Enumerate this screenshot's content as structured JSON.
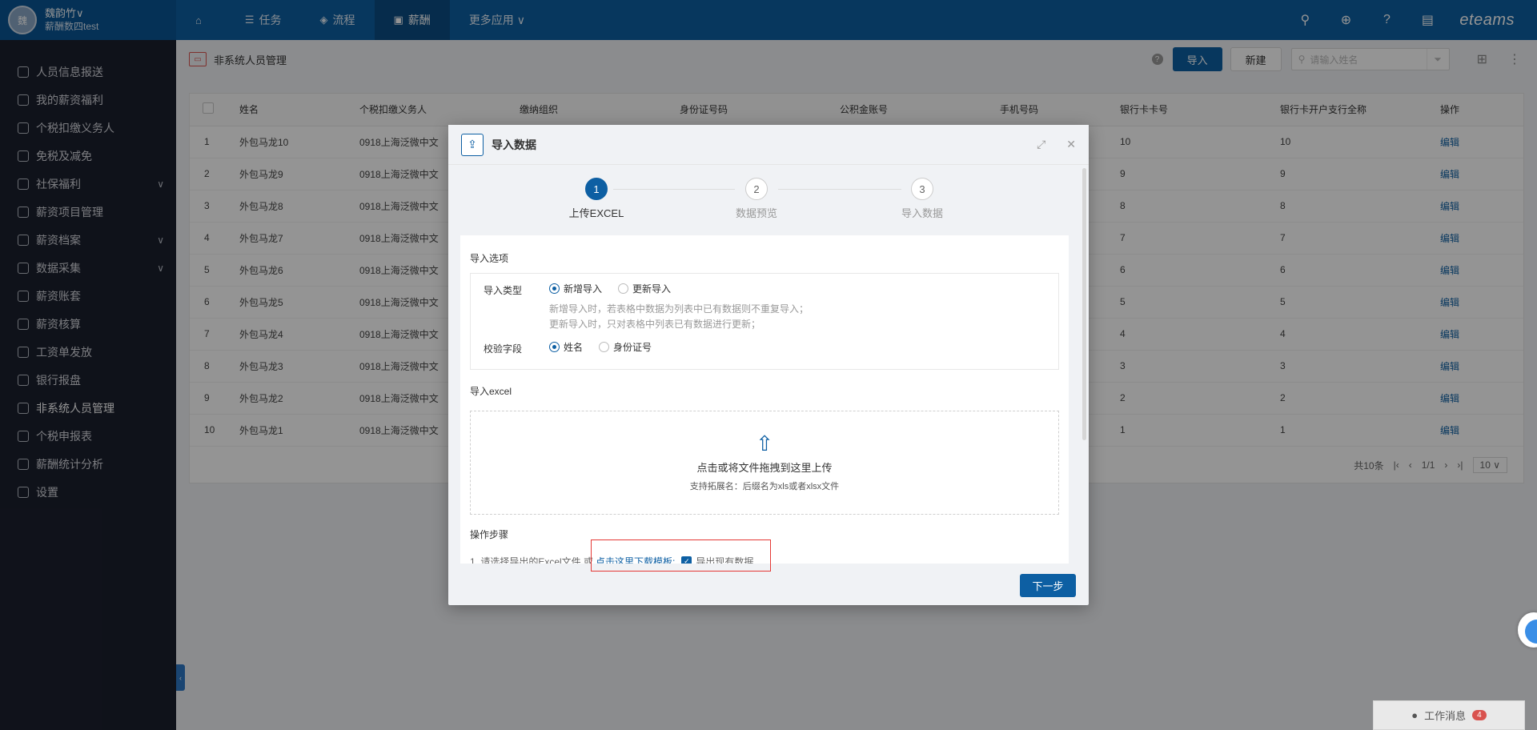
{
  "user": {
    "avatar": "魏",
    "name": "魏韵竹∨",
    "org": "薪酬数四test"
  },
  "nav": [
    {
      "icon": "⌂",
      "label": ""
    },
    {
      "icon": "☰",
      "label": "任务"
    },
    {
      "icon": "◈",
      "label": "流程"
    },
    {
      "icon": "▣",
      "label": "薪酬"
    },
    {
      "icon": "",
      "label": "更多应用 ∨"
    }
  ],
  "brand": "eteams",
  "sidebar": [
    {
      "label": "人员信息报送"
    },
    {
      "label": "我的薪资福利"
    },
    {
      "label": "个税扣缴义务人"
    },
    {
      "label": "免税及减免"
    },
    {
      "label": "社保福利",
      "chev": "∨"
    },
    {
      "label": "薪资项目管理"
    },
    {
      "label": "薪资档案",
      "chev": "∨"
    },
    {
      "label": "数据采集",
      "chev": "∨"
    },
    {
      "label": "薪资账套"
    },
    {
      "label": "薪资核算"
    },
    {
      "label": "工资单发放"
    },
    {
      "label": "银行报盘"
    },
    {
      "label": "非系统人员管理"
    },
    {
      "label": "个税申报表"
    },
    {
      "label": "薪酬统计分析"
    },
    {
      "label": "设置"
    }
  ],
  "page": {
    "title": "非系统人员管理",
    "import": "导入",
    "new": "新建",
    "search_placeholder": "请输入姓名"
  },
  "table": {
    "headers": [
      "姓名",
      "个税扣缴义务人",
      "缴纳组织",
      "身份证号码",
      "公积金账号",
      "手机号码",
      "银行卡卡号",
      "银行卡开户支行全称",
      "操作"
    ],
    "rows": [
      {
        "no": "1",
        "name": "外包马龙10",
        "tax": "0918上海泛微中文",
        "card": "10",
        "branch": "10",
        "op": "编辑"
      },
      {
        "no": "2",
        "name": "外包马龙9",
        "tax": "0918上海泛微中文",
        "card": "9",
        "branch": "9",
        "op": "编辑"
      },
      {
        "no": "3",
        "name": "外包马龙8",
        "tax": "0918上海泛微中文",
        "card": "8",
        "branch": "8",
        "op": "编辑"
      },
      {
        "no": "4",
        "name": "外包马龙7",
        "tax": "0918上海泛微中文",
        "card": "7",
        "branch": "7",
        "op": "编辑"
      },
      {
        "no": "5",
        "name": "外包马龙6",
        "tax": "0918上海泛微中文",
        "card": "6",
        "branch": "6",
        "op": "编辑"
      },
      {
        "no": "6",
        "name": "外包马龙5",
        "tax": "0918上海泛微中文",
        "card": "5",
        "branch": "5",
        "op": "编辑"
      },
      {
        "no": "7",
        "name": "外包马龙4",
        "tax": "0918上海泛微中文",
        "card": "4",
        "branch": "4",
        "op": "编辑"
      },
      {
        "no": "8",
        "name": "外包马龙3",
        "tax": "0918上海泛微中文",
        "card": "3",
        "branch": "3",
        "op": "编辑"
      },
      {
        "no": "9",
        "name": "外包马龙2",
        "tax": "0918上海泛微中文",
        "card": "2",
        "branch": "2",
        "op": "编辑"
      },
      {
        "no": "10",
        "name": "外包马龙1",
        "tax": "0918上海泛微中文",
        "card": "1",
        "branch": "1",
        "op": "编辑"
      }
    ]
  },
  "pager": {
    "total": "共10条",
    "page": "1/1",
    "size": "10 ∨"
  },
  "modal": {
    "title": "导入数据",
    "steps": [
      {
        "num": "1",
        "label": "上传EXCEL"
      },
      {
        "num": "2",
        "label": "数据预览"
      },
      {
        "num": "3",
        "label": "导入数据"
      }
    ],
    "options_title": "导入选项",
    "type_label": "导入类型",
    "type_options": [
      "新增导入",
      "更新导入"
    ],
    "hint1": "新增导入时，若表格中数据为列表中已有数据则不重复导入；",
    "hint2": "更新导入时，只对表格中列表已有数据进行更新；",
    "check_label": "校验字段",
    "check_options": [
      "姓名",
      "身份证号"
    ],
    "excel_title": "导入excel",
    "upload_text": "点击或将文件拖拽到这里上传",
    "upload_hint": "支持拓展名：后缀名为xls或者xlsx文件",
    "steps_title": "操作步骤",
    "op_text": "1. 请选择导出的Excel文件 或",
    "op_link": "点击这里下载模板;",
    "op_check": "导出现有数据",
    "next": "下一步"
  },
  "msg": {
    "label": "工作消息",
    "count": "4"
  }
}
